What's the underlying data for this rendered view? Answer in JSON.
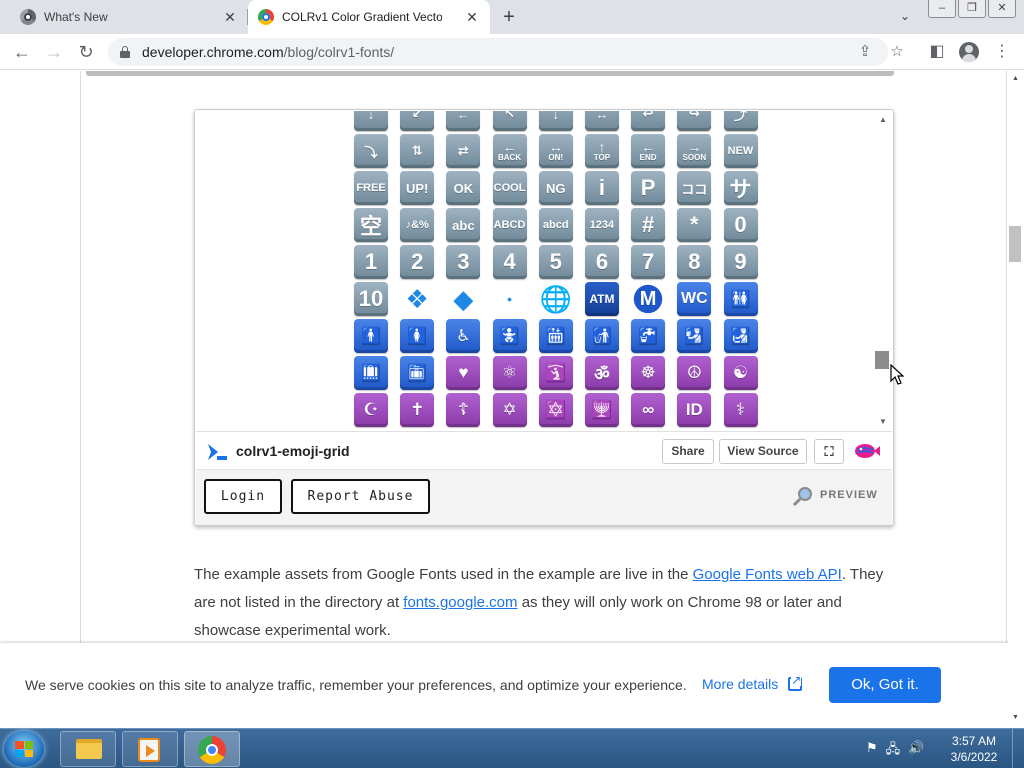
{
  "browser": {
    "tabs": [
      {
        "title": "What's New",
        "active": false
      },
      {
        "title": "COLRv1 Color Gradient Vector Fo",
        "active": true
      }
    ],
    "url_host": "developer.chrome.com",
    "url_path": "/blog/colrv1-fonts/"
  },
  "embed": {
    "title": "colrv1-emoji-grid",
    "share_label": "Share",
    "view_source_label": "View Source",
    "login_label": "Login",
    "report_label": "Report Abuse",
    "preview_label": "PREVIEW",
    "emoji_rows": [
      [
        {
          "kind": "k",
          "text": "↓"
        },
        {
          "kind": "k",
          "text": "↙"
        },
        {
          "kind": "k",
          "text": "←"
        },
        {
          "kind": "k",
          "text": "↖"
        },
        {
          "kind": "k",
          "text": "↓"
        },
        {
          "kind": "k",
          "text": "↔"
        },
        {
          "kind": "k",
          "text": "↩"
        },
        {
          "kind": "k",
          "text": "↪"
        },
        {
          "kind": "k",
          "text": "⤴"
        }
      ],
      [
        {
          "kind": "k",
          "text": "⤵"
        },
        {
          "kind": "k",
          "text": "⇅"
        },
        {
          "kind": "k",
          "text": "⇄"
        },
        {
          "kind": "k",
          "text": "←",
          "sub": "BACK"
        },
        {
          "kind": "k",
          "text": "↔",
          "sub": "ON!"
        },
        {
          "kind": "k",
          "text": "↑",
          "sub": "TOP"
        },
        {
          "kind": "k",
          "text": "←",
          "sub": "END"
        },
        {
          "kind": "k",
          "text": "→",
          "sub": "SOON"
        },
        {
          "kind": "k",
          "text": "NEW",
          "small": true
        }
      ],
      [
        {
          "kind": "k",
          "text": "FREE",
          "small": true
        },
        {
          "kind": "k",
          "text": "UP!"
        },
        {
          "kind": "k",
          "text": "OK"
        },
        {
          "kind": "k",
          "text": "COOL",
          "small": true
        },
        {
          "kind": "k",
          "text": "NG"
        },
        {
          "kind": "k",
          "text": "i",
          "big": true
        },
        {
          "kind": "k",
          "text": "P",
          "big": true
        },
        {
          "kind": "k",
          "text": "ココ"
        },
        {
          "kind": "k",
          "text": "サ",
          "big": true
        }
      ],
      [
        {
          "kind": "k",
          "text": "空",
          "big": true
        },
        {
          "kind": "k",
          "text": "♪&%",
          "small": true
        },
        {
          "kind": "k",
          "text": "abc"
        },
        {
          "kind": "k",
          "text": "ABCD",
          "small": true
        },
        {
          "kind": "k",
          "text": "abcd",
          "small": true
        },
        {
          "kind": "k",
          "text": "1234",
          "small": true
        },
        {
          "kind": "k",
          "text": "#",
          "big": true
        },
        {
          "kind": "k",
          "text": "*",
          "big": true
        },
        {
          "kind": "k",
          "text": "0",
          "big": true
        }
      ],
      [
        {
          "kind": "k",
          "text": "1",
          "big": true
        },
        {
          "kind": "k",
          "text": "2",
          "big": true
        },
        {
          "kind": "k",
          "text": "3",
          "big": true
        },
        {
          "kind": "k",
          "text": "4",
          "big": true
        },
        {
          "kind": "k",
          "text": "5",
          "big": true
        },
        {
          "kind": "k",
          "text": "6",
          "big": true
        },
        {
          "kind": "k",
          "text": "7",
          "big": true
        },
        {
          "kind": "k",
          "text": "8",
          "big": true
        },
        {
          "kind": "k",
          "text": "9",
          "big": true
        }
      ],
      [
        {
          "kind": "k",
          "text": "10",
          "big": true
        },
        {
          "kind": "t",
          "text": "❖"
        },
        {
          "kind": "t",
          "text": "◆"
        },
        {
          "kind": "t",
          "text": "⬩",
          "tiny": true
        },
        {
          "kind": "t",
          "text": "🌐"
        },
        {
          "kind": "atm",
          "text": "ATM"
        },
        {
          "kind": "circ",
          "text": "M"
        },
        {
          "kind": "b",
          "text": "WC"
        },
        {
          "kind": "b",
          "text": "🚻"
        }
      ],
      [
        {
          "kind": "b",
          "text": "🚹"
        },
        {
          "kind": "b",
          "text": "🚺"
        },
        {
          "kind": "b",
          "text": "♿"
        },
        {
          "kind": "b",
          "text": "🚼"
        },
        {
          "kind": "b",
          "text": "🛗"
        },
        {
          "kind": "b",
          "text": "🚮"
        },
        {
          "kind": "b",
          "text": "🚰"
        },
        {
          "kind": "b",
          "text": "🛂"
        },
        {
          "kind": "b",
          "text": "🛃"
        }
      ],
      [
        {
          "kind": "b",
          "text": "🛄"
        },
        {
          "kind": "b",
          "text": "🛅"
        },
        {
          "kind": "p",
          "text": "♥"
        },
        {
          "kind": "p",
          "text": "⚛"
        },
        {
          "kind": "p",
          "text": "🛐"
        },
        {
          "kind": "p",
          "text": "ॐ"
        },
        {
          "kind": "p",
          "text": "☸"
        },
        {
          "kind": "p",
          "text": "☮"
        },
        {
          "kind": "p",
          "text": "☯"
        }
      ],
      [
        {
          "kind": "p",
          "text": "☪"
        },
        {
          "kind": "p",
          "text": "✝"
        },
        {
          "kind": "p",
          "text": "☦"
        },
        {
          "kind": "p",
          "text": "✡"
        },
        {
          "kind": "p",
          "text": "🔯"
        },
        {
          "kind": "p",
          "text": "🕎"
        },
        {
          "kind": "p",
          "text": "∞"
        },
        {
          "kind": "p",
          "text": "ID"
        },
        {
          "kind": "p",
          "text": "⚕"
        }
      ]
    ]
  },
  "article": {
    "p1_before": "The example assets from Google Fonts used in the example are live in the ",
    "link1": "Google Fonts web API",
    "p1_after": ". They are not listed in the directory at ",
    "link2": "fonts.google.com",
    "p1_end": " as they will only work on Chrome 98 or later and showcase experimental work."
  },
  "cookie": {
    "text": "We serve cookies on this site to analyze traffic, remember your preferences, and optimize your experience.",
    "more_label": "More details",
    "ok_label": "Ok, Got it."
  },
  "taskbar": {
    "time": "3:57 AM",
    "date": "3/6/2022"
  },
  "colors": {
    "accent": "#1a73e8",
    "key_gray": "#8aa0b0",
    "sign_blue": "#1f57c9",
    "religion_purple": "#9c48bd"
  }
}
